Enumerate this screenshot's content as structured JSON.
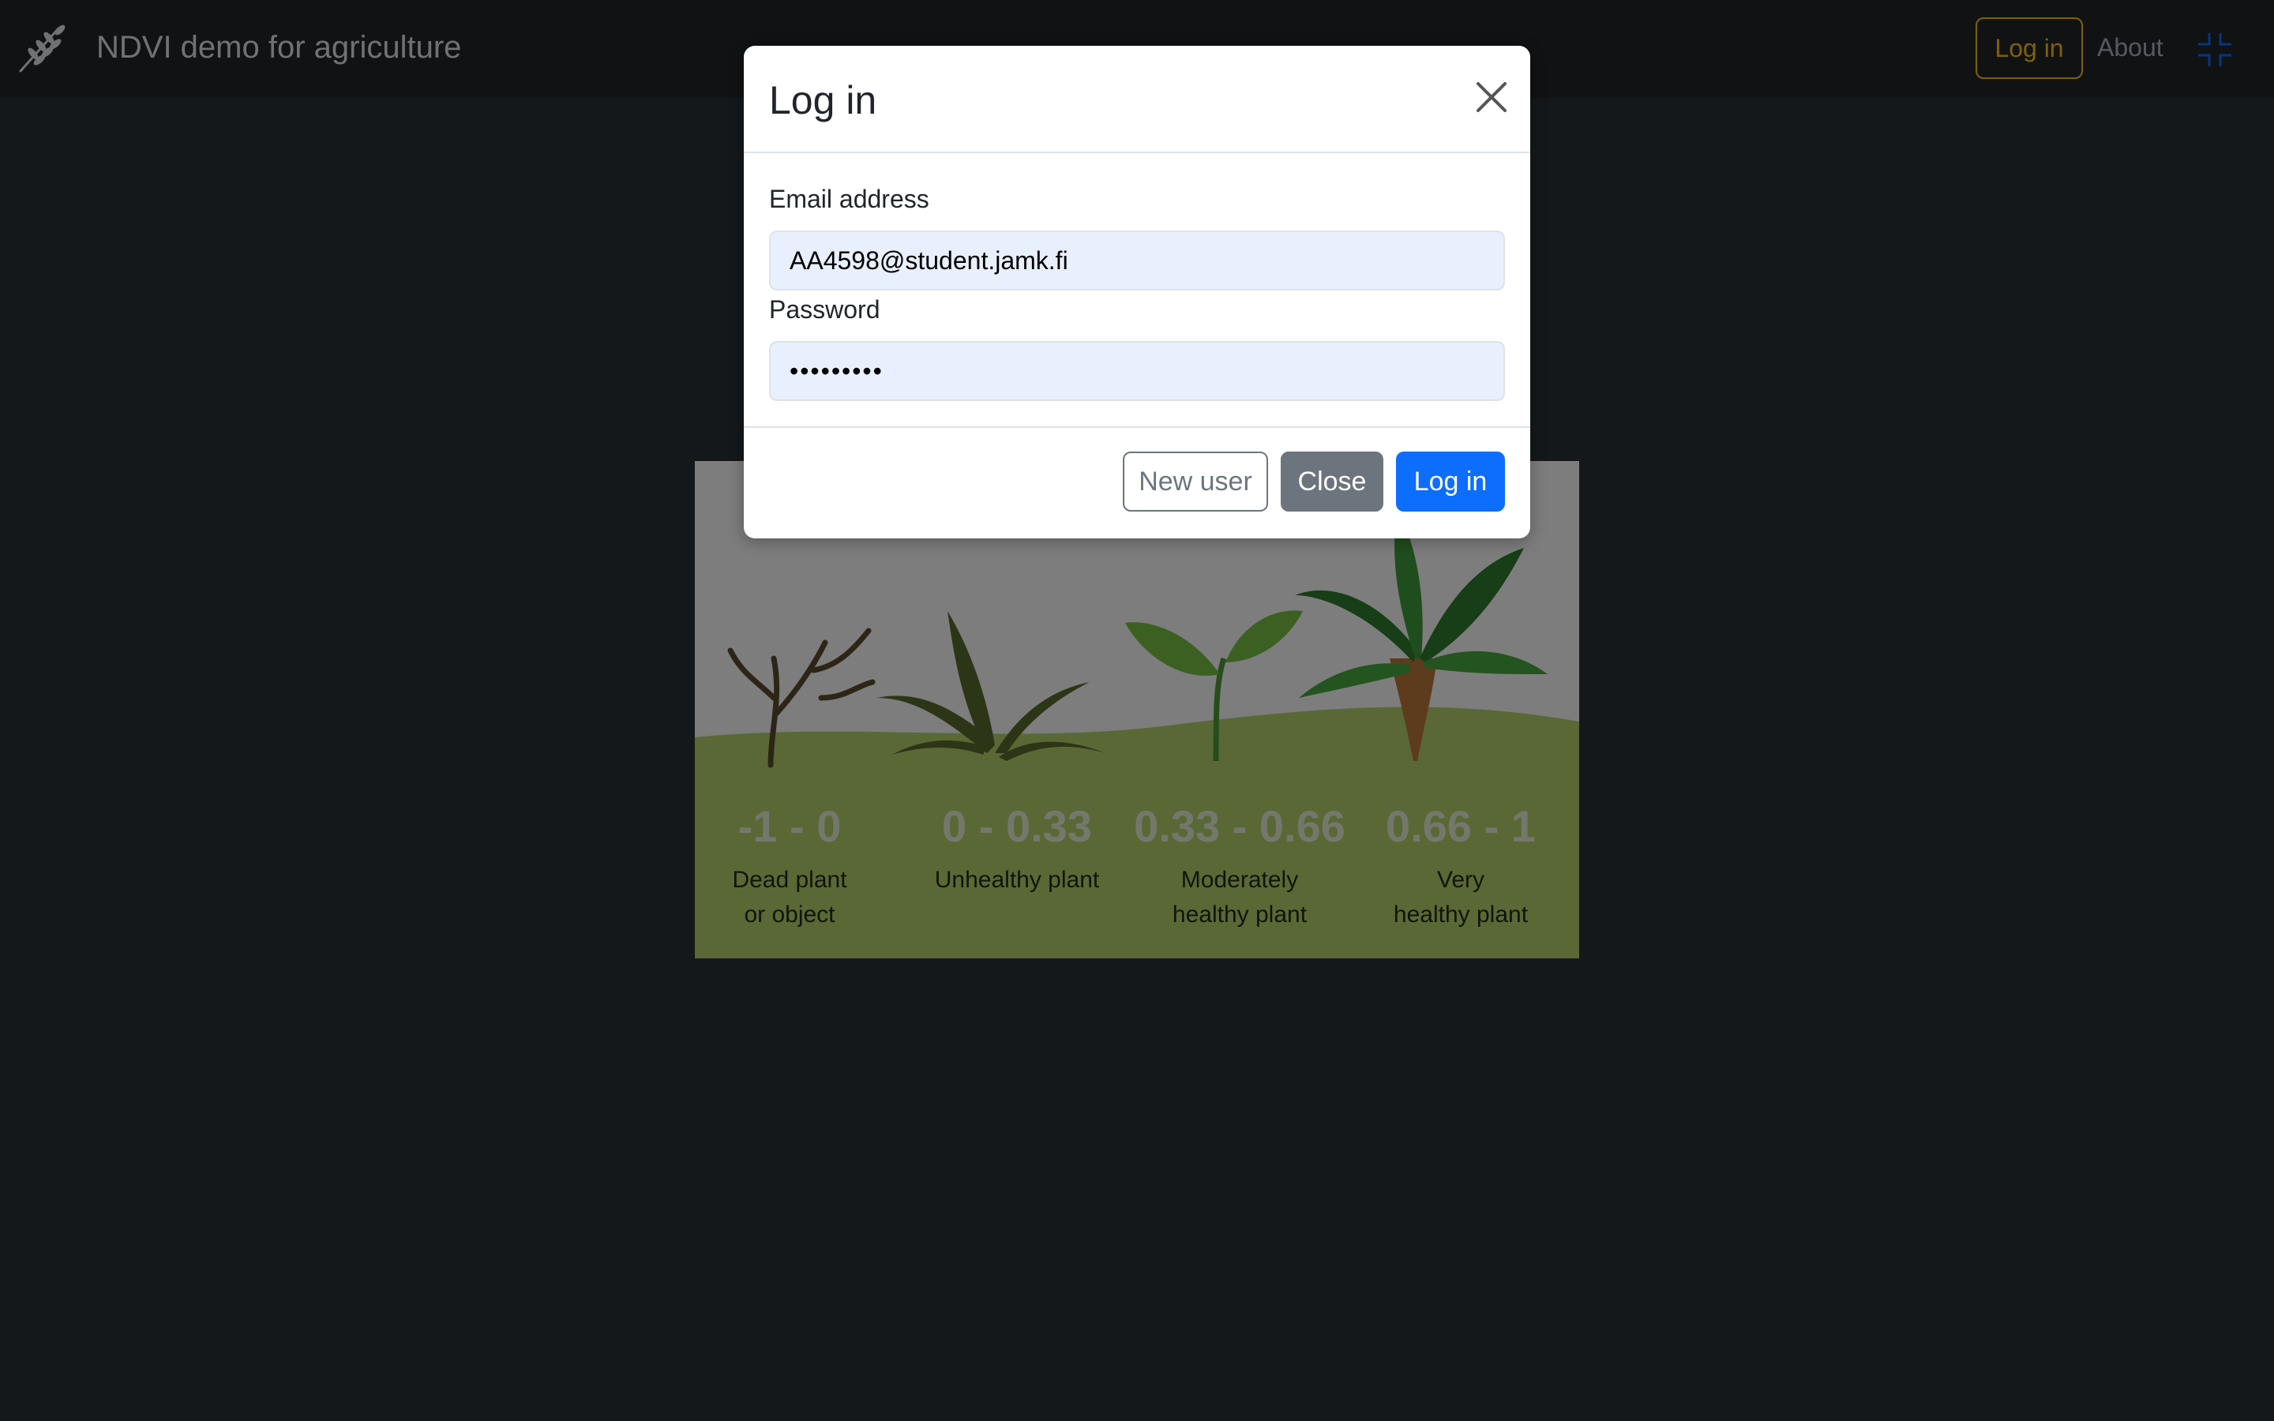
{
  "navbar": {
    "brand_title": "NDVI demo for agriculture",
    "brand_icon": "wheat-icon",
    "login_label": "Log in",
    "about_label": "About",
    "collapse_icon": "fullscreen-exit-icon"
  },
  "ndvi_legend": {
    "categories": [
      {
        "range": "-1 - 0",
        "label": "Dead plant\nor  object"
      },
      {
        "range": "0 - 0.33",
        "label": "Unhealthy plant"
      },
      {
        "range": "0.33 - 0.66",
        "label": "Moderately\nhealthy plant"
      },
      {
        "range": "0.66 - 1",
        "label": "Very\nhealthy plant"
      }
    ]
  },
  "modal": {
    "title": "Log in",
    "close_icon": "close-icon",
    "email_label": "Email address",
    "email_value": "AA4598@student.jamk.fi",
    "password_label": "Password",
    "password_value": "•••••••••",
    "new_user_label": "New user",
    "close_label": "Close",
    "login_label": "Log in"
  },
  "colors": {
    "navbar_bg": "#212529",
    "page_bg": "#2b3035",
    "accent_warning": "#ffc107",
    "primary": "#0d6efd",
    "secondary": "#6c757d",
    "autofill_bg": "#e8f0fe",
    "legend_ground": "#b5d16d"
  }
}
